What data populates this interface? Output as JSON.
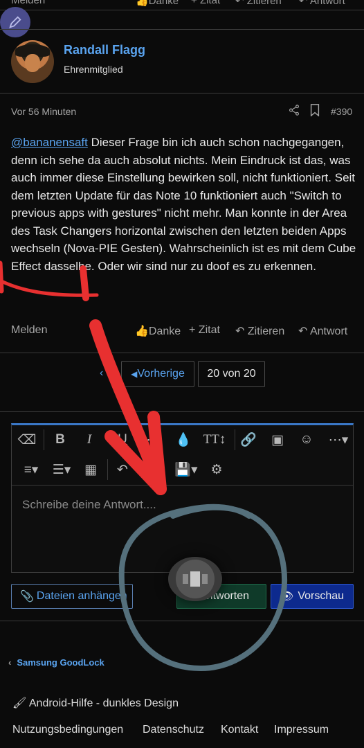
{
  "top_actions": {
    "report": "Melden",
    "thanks": "Danke",
    "quote": "Zitat",
    "cite": "Zitieren",
    "reply": "Antwort"
  },
  "author": {
    "name": "Randall Flagg",
    "title": "Ehrenmitglied"
  },
  "post": {
    "time": "Vor 56 Minuten",
    "number": "#390",
    "mention": "@bananensaft",
    "text": " Dieser Frage bin ich auch schon nachgegangen, denn ich sehe da auch absolut nichts. Mein Eindruck ist das, was auch immer diese Einstellung bewirken soll, nicht funktioniert. Seit dem letzten Update für das Note 10 funktioniert auch \"Switch to previous apps with gestures\" nicht mehr. Man konnte in der Area des Task Changers horizontal zwischen den letzten beiden Apps wechseln (Nova-PIE Gesten). Wahrscheinlich ist es mit dem Cube Effect dasselbe. Oder wir sind nur zu doof es zu erkennen."
  },
  "post_actions": {
    "report": "Melden",
    "thanks": "Danke",
    "quote": "Zitat",
    "cite": "Zitieren",
    "reply": "Antwort"
  },
  "pagination": {
    "prev": "Vorherige",
    "page": "20 von 20"
  },
  "editor": {
    "placeholder": "Schreibe deine Antwort...."
  },
  "buttons": {
    "attach": "Dateien anhängen",
    "reply": "Antworten",
    "preview": "Vorschau"
  },
  "footer": {
    "breadcrumb": "Samsung GoodLock",
    "style": "Android-Hilfe - dunkles Design",
    "links": [
      "Nutzungsbedingungen",
      "Datenschutz",
      "Kontakt",
      "Impressum"
    ]
  },
  "colors": {
    "link": "#5aa4f0",
    "accent": "#3a78c8",
    "annotation_red": "#e83030",
    "annotation_circle": "#55707c"
  }
}
